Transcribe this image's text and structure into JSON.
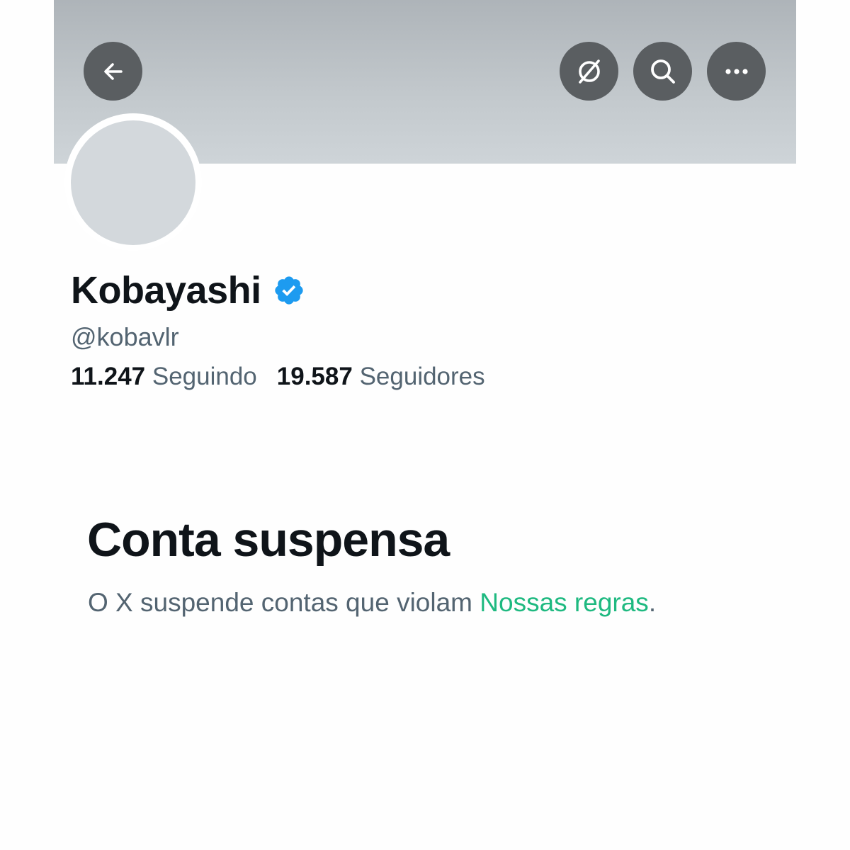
{
  "header": {
    "back_icon": "arrow-left-icon",
    "grok_icon": "grok-slash-circle-icon",
    "search_icon": "search-icon",
    "more_icon": "more-horizontal-icon",
    "button_color": "#5a5e61"
  },
  "profile": {
    "display_name": "Kobayashi",
    "verified": true,
    "verified_color": "#1d9bf0",
    "handle": "@kobavlr",
    "following_count": "11.247",
    "following_label": "Seguindo",
    "followers_count": "19.587",
    "followers_label": "Seguidores"
  },
  "suspension": {
    "title": "Conta suspensa",
    "message": "O X suspende contas que violam",
    "rules_link": "Nossas regras",
    "trailing": ".",
    "link_color": "#1eb980"
  }
}
